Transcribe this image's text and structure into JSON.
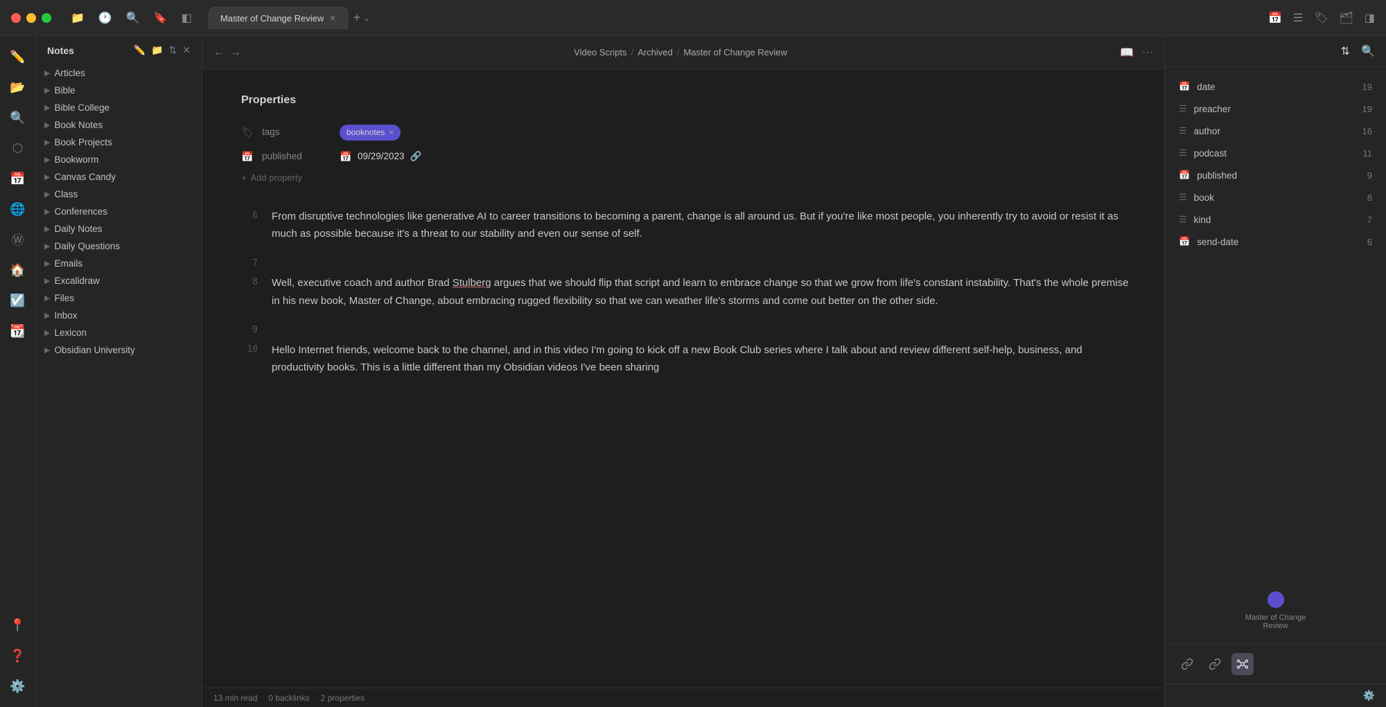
{
  "titlebar": {
    "tab_label": "Master of Change Review",
    "tab_add_label": "+",
    "tab_dropdown_label": "⌄"
  },
  "toolbar_icons": {
    "file": "📁",
    "history": "🕐",
    "search": "🔍",
    "bookmark": "🔖",
    "layout": "◧"
  },
  "titlebar_right": {
    "calendar": "📅",
    "list": "☰",
    "tag": "🏷",
    "archive": "🗂",
    "panel": "◨"
  },
  "sidebar": {
    "title": "Notes",
    "items": [
      {
        "label": "Articles"
      },
      {
        "label": "Bible"
      },
      {
        "label": "Bible College"
      },
      {
        "label": "Book Notes"
      },
      {
        "label": "Book Projects"
      },
      {
        "label": "Bookworm"
      },
      {
        "label": "Canvas Candy"
      },
      {
        "label": "Class"
      },
      {
        "label": "Conferences"
      },
      {
        "label": "Daily Notes"
      },
      {
        "label": "Daily Questions"
      },
      {
        "label": "Emails"
      },
      {
        "label": "Excalidraw"
      },
      {
        "label": "Files"
      },
      {
        "label": "Inbox"
      },
      {
        "label": "Lexicon"
      },
      {
        "label": "Obsidian University"
      }
    ]
  },
  "breadcrumb": {
    "part1": "Video Scripts",
    "sep1": "/",
    "part2": "Archived",
    "sep2": "/",
    "part3": "Master of Change Review"
  },
  "properties": {
    "title": "Properties",
    "tags_key": "tags",
    "tags_value": "booknotes",
    "tags_x": "×",
    "published_key": "published",
    "published_value": "09/29/2023",
    "add_property": "Add property"
  },
  "doc_lines": [
    {
      "num": "6",
      "text": "From disruptive technologies like generative AI to career transitions to becoming a parent, change is all around us. But if you're like most people, you inherently try to avoid or resist it as much as possible because it's a threat to our stability and even our sense of self."
    },
    {
      "num": "7",
      "text": ""
    },
    {
      "num": "8",
      "text": "Well, executive coach and author Brad Stulberg argues that we should flip that script and learn to embrace change so that we grow from life's constant instability. That's the whole premise in his new book, Master of Change, about embracing rugged flexibility so that we can weather life's storms and come out better on the other side."
    },
    {
      "num": "9",
      "text": ""
    },
    {
      "num": "10",
      "text": "Hello Internet friends, welcome back to the channel, and in this video I'm going to kick off a new Book Club series where I talk about and review different self-help, business, and productivity books. This is a little different than my Obsidian videos I've been sharing"
    }
  ],
  "right_panel": {
    "properties": [
      {
        "icon": "📅",
        "type": "calendar",
        "label": "date",
        "count": 19
      },
      {
        "icon": "☰",
        "type": "list",
        "label": "preacher",
        "count": 19
      },
      {
        "icon": "☰",
        "type": "list",
        "label": "author",
        "count": 16
      },
      {
        "icon": "☰",
        "type": "list",
        "label": "podcast",
        "count": 11
      },
      {
        "icon": "📅",
        "type": "calendar",
        "label": "published",
        "count": 9
      },
      {
        "icon": "☰",
        "type": "list",
        "label": "book",
        "count": 8
      },
      {
        "icon": "☰",
        "type": "list",
        "label": "kind",
        "count": 7
      },
      {
        "icon": "📅",
        "type": "calendar",
        "label": "send-date",
        "count": 6
      }
    ],
    "minimap_label": "Master of Change Review"
  },
  "status_bar": {
    "read_time": "13 min read",
    "backlinks": "0 backlinks",
    "properties_count": "2 properties"
  }
}
